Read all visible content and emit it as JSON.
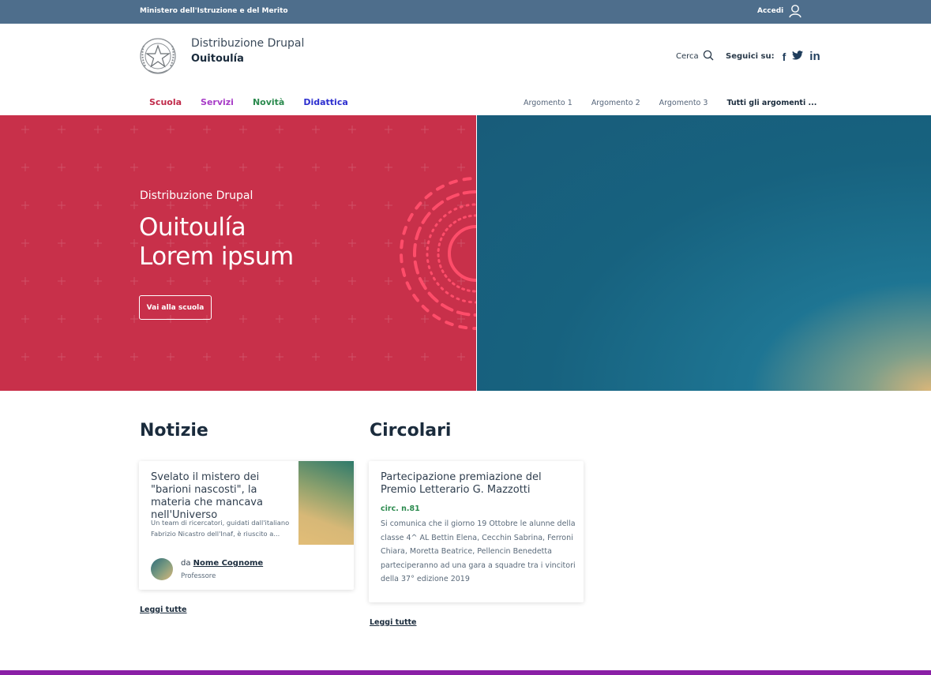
{
  "topbar": {
    "ministry": "Ministero dell'Istruzione e del Merito",
    "login_label": "Accedi",
    "login_icon": "user-icon"
  },
  "header": {
    "brand_top": "Distribuzione Drupal",
    "brand_name": "Ouitoulía",
    "emblem_icon": "italian-republic-emblem-icon",
    "search_label": "Cerca",
    "search_icon": "search-icon",
    "follow_label": "Seguici su:",
    "social": [
      {
        "icon": "facebook-icon",
        "glyph": "f"
      },
      {
        "icon": "twitter-icon",
        "glyph": "🐦"
      },
      {
        "icon": "linkedin-icon",
        "glyph": "in"
      }
    ]
  },
  "nav": {
    "main": [
      "Scuola",
      "Servizi",
      "Novità",
      "Didattica"
    ],
    "main_colors": [
      "#c02a4a",
      "#a73bc7",
      "#2b8a4e",
      "#2d2fcf"
    ],
    "topics": [
      "Argomento 1",
      "Argomento 2",
      "Argomento 3",
      "Tutti gli argomenti ..."
    ]
  },
  "hero": {
    "subtitle": "Distribuzione Drupal",
    "title_line1": "Ouitoulía",
    "title_line2": "Lorem ipsum",
    "button": "Vai alla scuola",
    "left_color": "#c8304a"
  },
  "news": {
    "heading": "Notizie",
    "card": {
      "title": "Svelato il mistero dei \"barioni nascosti\", la materia che mancava nell'Universo",
      "excerpt": "Un team di ricercatori, guidati dall'italiano Fabrizio Nicastro dell'Inaf, è riuscito a...",
      "by_prefix": "da",
      "author": "Nome Cognome",
      "role": "Professore"
    },
    "read_all": "Leggi tutte"
  },
  "circulars": {
    "heading": "Circolari",
    "card": {
      "title": "Partecipazione premiazione del Premio Letterario G. Mazzotti",
      "number": "circ. n.81",
      "text": "Si comunica che il giorno 19 Ottobre le alunne della classe 4^ AL Bettin Elena, Cecchin Sabrina, Ferroni Chiara, Moretta Beatrice, Pellencin Benedetta parteciperanno ad una gara a squadre tra i vincitori della 37° edizione 2019"
    },
    "read_all": "Leggi tutte"
  },
  "footer": {
    "strip_color": "#8a1fa6"
  }
}
